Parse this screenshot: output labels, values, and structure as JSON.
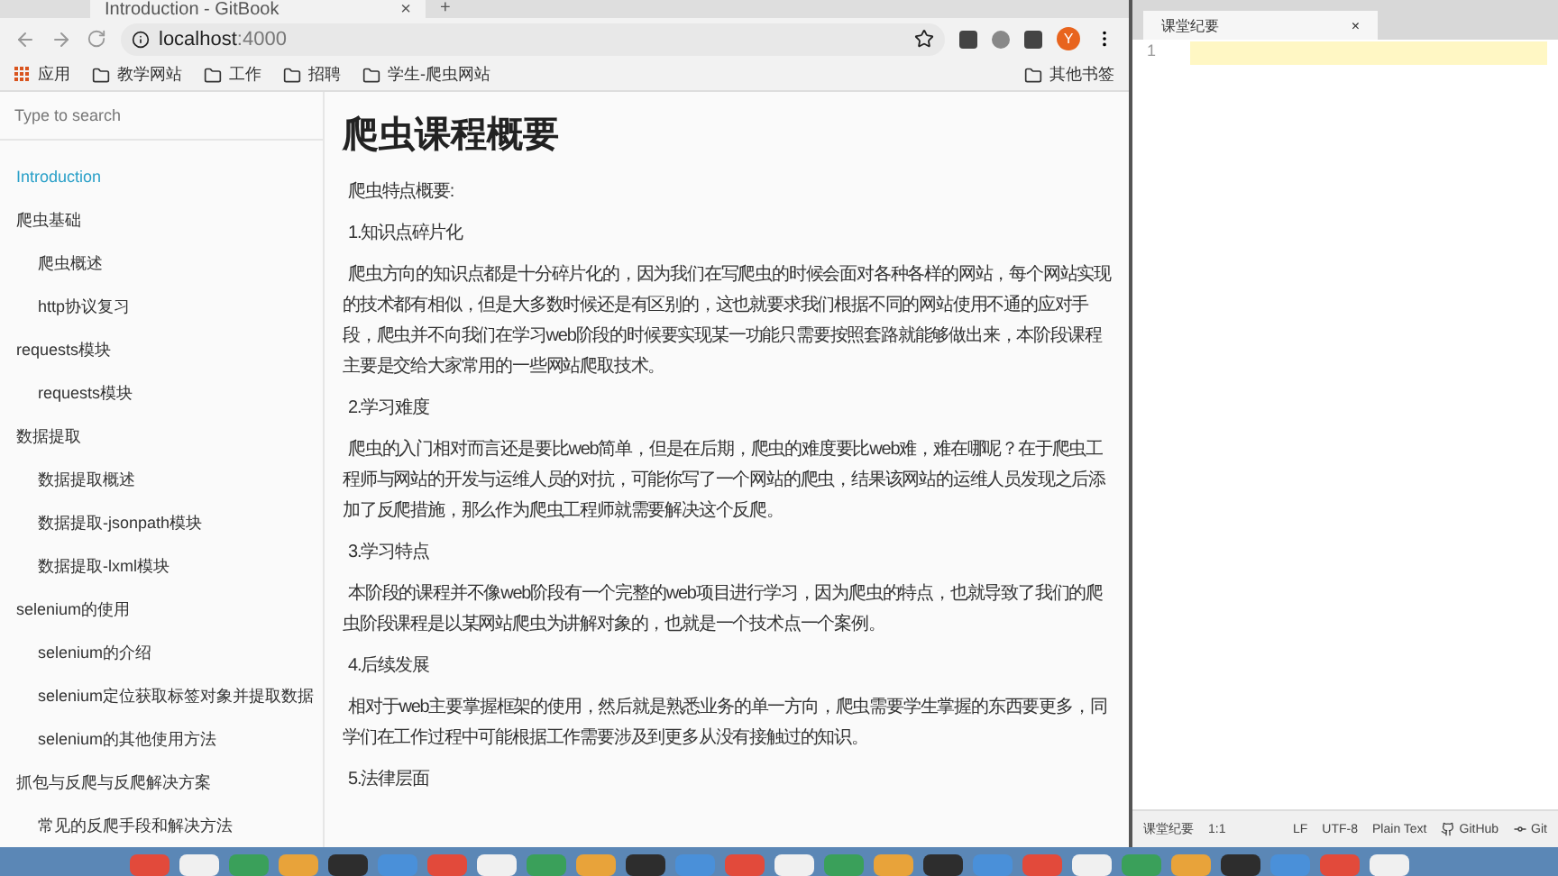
{
  "browser": {
    "tab": {
      "title": "Introduction - GitBook",
      "close": "×"
    },
    "new_tab": "+",
    "address": {
      "host": "localhost",
      "port": ":4000"
    },
    "avatar": "Y",
    "bookmarks": [
      {
        "kind": "apps",
        "label": "应用"
      },
      {
        "kind": "folder",
        "label": "教学网站"
      },
      {
        "kind": "folder",
        "label": "工作"
      },
      {
        "kind": "folder",
        "label": "招聘"
      },
      {
        "kind": "folder",
        "label": "学生-爬虫网站"
      }
    ],
    "other_bookmarks": "其他书签"
  },
  "sidebar": {
    "search": {
      "placeholder": "Type to search"
    },
    "items": [
      {
        "label": "Introduction",
        "selected": true
      },
      {
        "label": "爬虫基础",
        "selected": false,
        "children": [
          {
            "label": "爬虫概述",
            "selected": false
          },
          {
            "label": "http协议复习",
            "selected": false
          }
        ]
      },
      {
        "label": "requests模块",
        "selected": false,
        "children": [
          {
            "label": "requests模块",
            "selected": false
          }
        ]
      },
      {
        "label": "数据提取",
        "selected": false,
        "children": [
          {
            "label": "数据提取概述",
            "selected": false
          },
          {
            "label": "数据提取-jsonpath模块",
            "selected": false
          },
          {
            "label": "数据提取-lxml模块",
            "selected": false
          }
        ]
      },
      {
        "label": "selenium的使用",
        "selected": false,
        "children": [
          {
            "label": "selenium的介绍",
            "selected": false
          },
          {
            "label": "selenium定位获取标签对象并提取数据",
            "selected": false
          },
          {
            "label": "selenium的其他使用方法",
            "selected": false
          }
        ]
      },
      {
        "label": "抓包与反爬与反爬解决方案",
        "selected": false,
        "children": [
          {
            "label": "常见的反爬手段和解决方法",
            "selected": false
          }
        ]
      }
    ]
  },
  "article": {
    "title": "爬虫课程概要",
    "blocks": [
      {
        "kind": "paragraph",
        "text": "爬虫特点概要:"
      },
      {
        "kind": "heading",
        "text": "1.知识点碎片化"
      },
      {
        "kind": "paragraph",
        "text": "爬虫方向的知识点都是十分碎片化的，因为我们在写爬虫的时候会面对各种各样的网站，每个网站实现的技术都有相似，但是大多数时候还是有区别的，这也就要求我们根据不同的网站使用不通的应对手段，爬虫并不向我们在学习web阶段的时候要实现某一功能只需要按照套路就能够做出来，本阶段课程主要是交给大家常用的一些网站爬取技术。"
      },
      {
        "kind": "heading",
        "text": "2.学习难度"
      },
      {
        "kind": "paragraph",
        "text": "爬虫的入门相对而言还是要比web简单，但是在后期，爬虫的难度要比web难，难在哪呢？在于爬虫工程师与网站的开发与运维人员的对抗，可能你写了一个网站的爬虫，结果该网站的运维人员发现之后添加了反爬措施，那么作为爬虫工程师就需要解决这个反爬。"
      },
      {
        "kind": "heading",
        "text": "3.学习特点"
      },
      {
        "kind": "paragraph",
        "text": "本阶段的课程并不像web阶段有一个完整的web项目进行学习，因为爬虫的特点，也就导致了我们的爬虫阶段课程是以某网站爬虫为讲解对象的，也就是一个技术点一个案例。"
      },
      {
        "kind": "heading",
        "text": "4.后续发展"
      },
      {
        "kind": "paragraph",
        "text": "相对于web主要掌握框架的使用，然后就是熟悉业务的单一方向，爬虫需要学生掌握的东西要更多，同学们在工作过程中可能根据工作需要涉及到更多从没有接触过的知识。"
      },
      {
        "kind": "heading",
        "text": "5.法律层面"
      }
    ]
  },
  "editor": {
    "tab": {
      "title": "课堂纪要",
      "close": "×"
    },
    "line_number": "1",
    "status_bar": {
      "file": "课堂纪要",
      "position": "1:1",
      "line_ending": "LF",
      "encoding": "UTF-8",
      "grammar": "Plain Text",
      "github": "GitHub",
      "git": "Git"
    }
  }
}
